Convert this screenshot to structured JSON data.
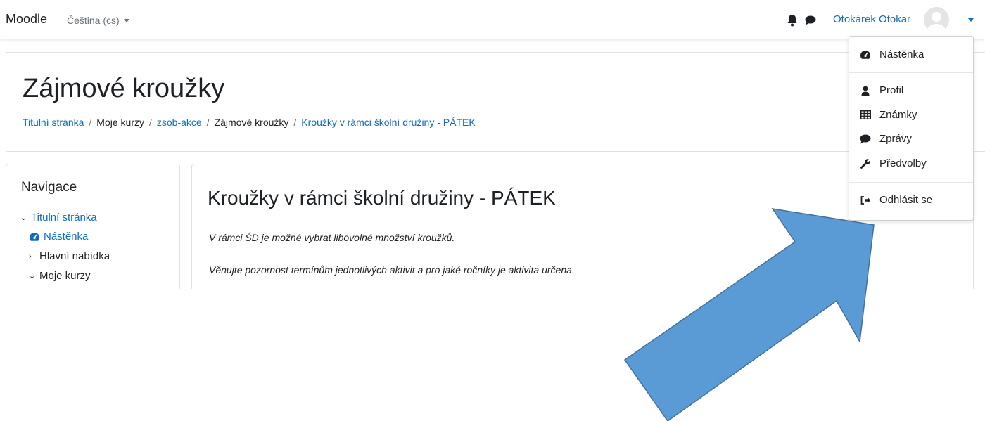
{
  "navbar": {
    "brand": "Moodle",
    "language": "Čeština (cs)",
    "username": "Otokárek Otokar",
    "icons": [
      "bell-icon",
      "chat-icon",
      "avatar-icon",
      "caret-down-icon"
    ]
  },
  "header": {
    "title": "Zájmové kroužky",
    "breadcrumb": [
      {
        "label": "Titulní stránka",
        "link": true
      },
      {
        "label": "Moje kurzy",
        "link": false
      },
      {
        "label": "zsob-akce",
        "link": true
      },
      {
        "label": "Zájmové kroužky",
        "link": false
      },
      {
        "label": "Kroužky v rámci školní družiny - PÁTEK",
        "link": true
      }
    ]
  },
  "navigation": {
    "heading": "Navigace",
    "items": [
      {
        "label": "Titulní stránka",
        "icon": "chevron-down-icon",
        "link": true
      },
      {
        "label": "Nástěnka",
        "icon": "dashboard-icon",
        "link": true
      },
      {
        "label": "Hlavní nabídka",
        "icon": "chevron-right-icon",
        "link": false
      },
      {
        "label": "Moje kurzy",
        "icon": "chevron-down-icon",
        "link": false
      }
    ]
  },
  "main": {
    "title": "Kroužky v rámci školní družiny - PÁTEK",
    "paragraphs": [
      "V rámci ŠD je možné vybrat libovolné množství kroužků.",
      "Věnujte pozornost termínům jednotlivých aktivit a pro jaké ročníky je aktivita určena."
    ]
  },
  "user_menu": {
    "items": [
      {
        "label": "Nástěnka",
        "icon": "dashboard-icon"
      },
      {
        "label": "Profil",
        "icon": "user-icon"
      },
      {
        "label": "Známky",
        "icon": "table-icon"
      },
      {
        "label": "Zprávy",
        "icon": "chat-icon"
      },
      {
        "label": "Předvolby",
        "icon": "wrench-icon"
      },
      {
        "label": "Odhlásit se",
        "icon": "sign-out-icon"
      }
    ]
  },
  "annotation": {
    "shape": "arrow",
    "color": "#5b9bd5",
    "stroke": "#41719c"
  },
  "colors": {
    "link": "#0f6cbf",
    "text": "#1d2125",
    "muted": "#6a737b"
  }
}
